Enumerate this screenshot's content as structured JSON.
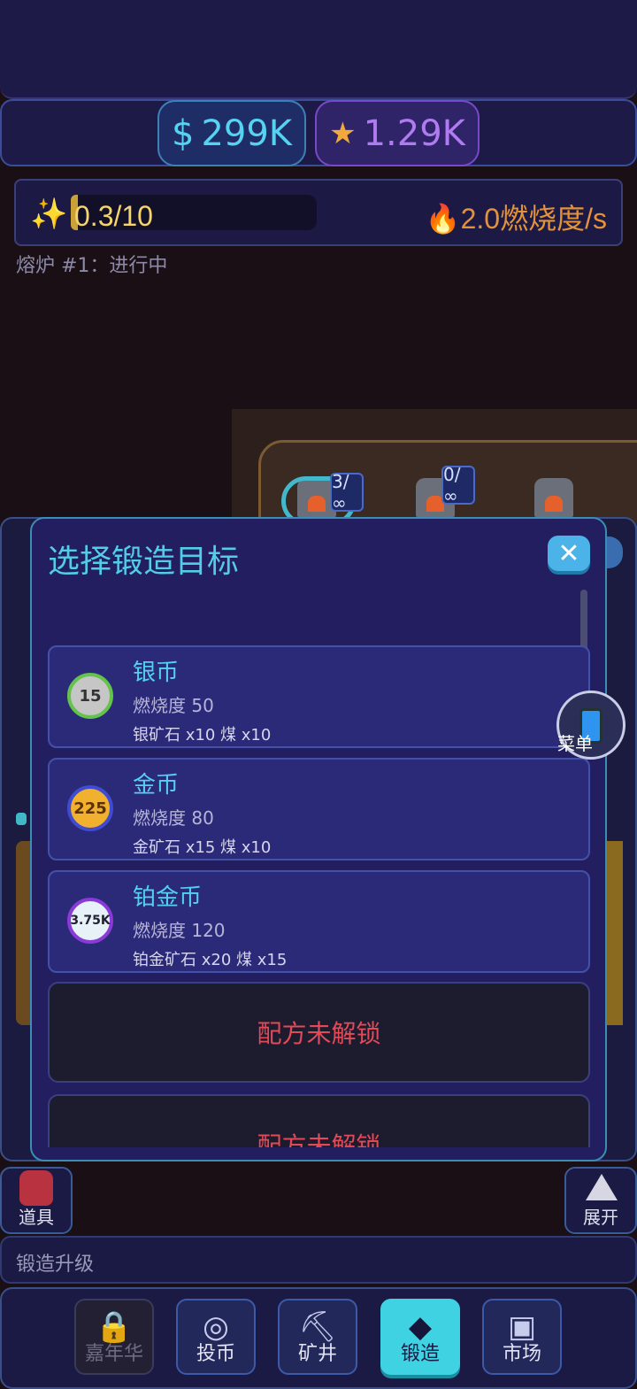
{
  "currency": {
    "money_symbol": "$",
    "money": "299K",
    "stars": "1.29K"
  },
  "status": {
    "progress_text": "0.3/10",
    "progress_fraction": 0.03,
    "burn_rate": "2.0燃烧度/s",
    "furnace_status": "熔炉 #1：进行中"
  },
  "scene": {
    "counters": [
      "3/∞",
      "0/∞"
    ]
  },
  "modal": {
    "title": "选择锻造目标",
    "close_icon": "close-icon",
    "recipes": [
      {
        "name": "银币",
        "coin_label": "15",
        "burn": "燃烧度 50",
        "materials": "银矿石 x10  煤 x10"
      },
      {
        "name": "金币",
        "coin_label": "225",
        "burn": "燃烧度 80",
        "materials": "金矿石 x15  煤 x10"
      },
      {
        "name": "铂金币",
        "coin_label": "3.75K",
        "burn": "燃烧度 120",
        "materials": "铂金矿石 x20  煤 x15"
      }
    ],
    "locked_label": "配方未解锁"
  },
  "menu": {
    "label": "菜单"
  },
  "side": {
    "items_label": "道具",
    "expand_label": "展开"
  },
  "upgrade": {
    "label": "锻造升级"
  },
  "nav": [
    {
      "label": "嘉年华",
      "icon": "lock-icon"
    },
    {
      "label": "投币",
      "icon": "coin-icon"
    },
    {
      "label": "矿井",
      "icon": "pickaxe-icon"
    },
    {
      "label": "锻造",
      "icon": "diamond-icon"
    },
    {
      "label": "市场",
      "icon": "market-icon"
    }
  ]
}
